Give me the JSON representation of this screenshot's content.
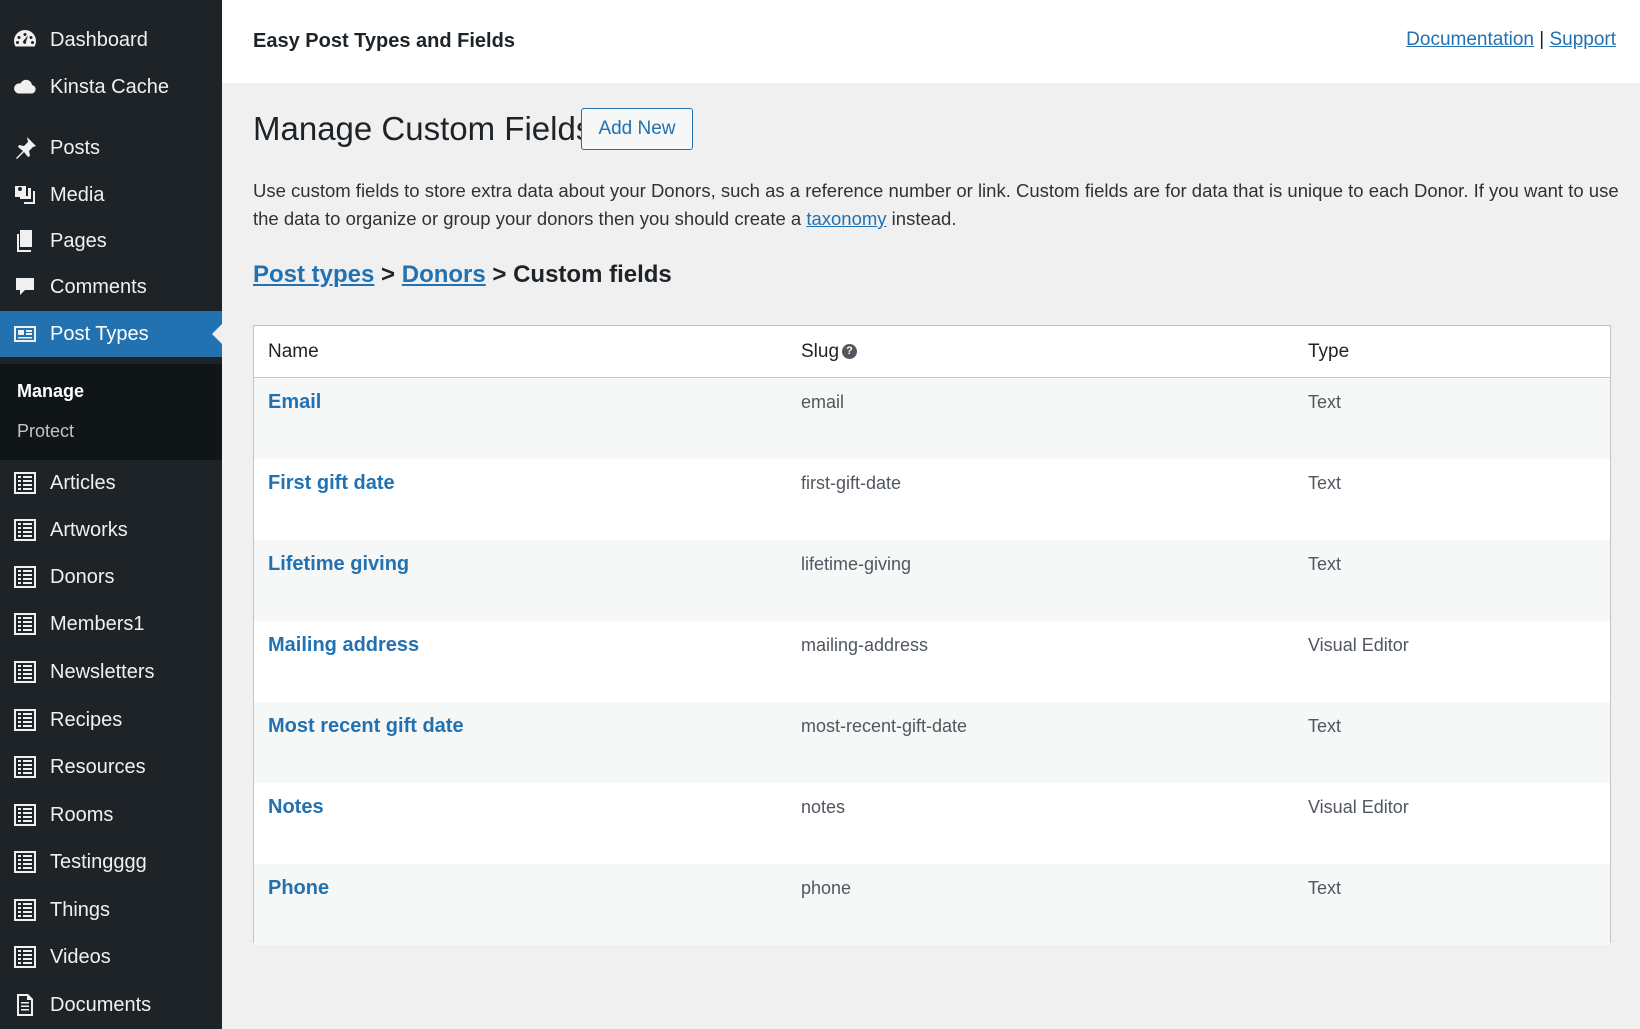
{
  "sidebar": {
    "top_items": [
      {
        "label": "Dashboard",
        "icon": "dashboard-icon"
      },
      {
        "label": "Kinsta Cache",
        "icon": "cloud-icon"
      },
      {
        "label": "Posts",
        "icon": "pin-icon"
      },
      {
        "label": "Media",
        "icon": "media-icon"
      },
      {
        "label": "Pages",
        "icon": "pages-icon"
      },
      {
        "label": "Comments",
        "icon": "comments-icon"
      },
      {
        "label": "Post Types",
        "icon": "post-types-icon"
      }
    ],
    "submenu": [
      {
        "label": "Manage"
      },
      {
        "label": "Protect"
      }
    ],
    "post_type_items": [
      {
        "label": "Articles",
        "icon": "list-icon"
      },
      {
        "label": "Artworks",
        "icon": "list-icon"
      },
      {
        "label": "Donors",
        "icon": "list-icon"
      },
      {
        "label": "Members1",
        "icon": "list-icon"
      },
      {
        "label": "Newsletters",
        "icon": "list-icon"
      },
      {
        "label": "Recipes",
        "icon": "list-icon"
      },
      {
        "label": "Resources",
        "icon": "list-icon"
      },
      {
        "label": "Rooms",
        "icon": "list-icon"
      },
      {
        "label": "Testingggg",
        "icon": "list-icon"
      },
      {
        "label": "Things",
        "icon": "list-icon"
      },
      {
        "label": "Videos",
        "icon": "list-icon"
      },
      {
        "label": "Documents",
        "icon": "document-icon"
      }
    ]
  },
  "header": {
    "plugin_title": "Easy Post Types and Fields",
    "documentation_link": "Documentation",
    "separator": "|",
    "support_link": "Support"
  },
  "main": {
    "title": "Manage Custom Fields",
    "add_new_label": "Add New",
    "intro_before_link": "Use custom fields to store extra data about your Donors, such as a reference number or link. Custom fields are for data that is unique to each Donor. If you want to use the data to organize or group your donors then you should create a ",
    "intro_link": "taxonomy",
    "intro_after_link": " instead.",
    "breadcrumb": {
      "post_types": "Post types",
      "sep1": ">",
      "donors": "Donors",
      "sep2": ">",
      "current": "Custom fields"
    }
  },
  "table": {
    "columns": {
      "name": "Name",
      "slug": "Slug",
      "type": "Type"
    },
    "help_glyph": "?",
    "rows": [
      {
        "name": "Email",
        "slug": "email",
        "type": "Text"
      },
      {
        "name": "First gift date",
        "slug": "first-gift-date",
        "type": "Text"
      },
      {
        "name": "Lifetime giving",
        "slug": "lifetime-giving",
        "type": "Text"
      },
      {
        "name": "Mailing address",
        "slug": "mailing-address",
        "type": "Visual Editor"
      },
      {
        "name": "Most recent gift date",
        "slug": "most-recent-gift-date",
        "type": "Text"
      },
      {
        "name": "Notes",
        "slug": "notes",
        "type": "Visual Editor"
      },
      {
        "name": "Phone",
        "slug": "phone",
        "type": "Text"
      }
    ]
  },
  "colors": {
    "sidebar_bg": "#1d2327",
    "active_menu": "#2271b1",
    "link": "#2271b1",
    "page_bg": "#f0f0f1"
  }
}
